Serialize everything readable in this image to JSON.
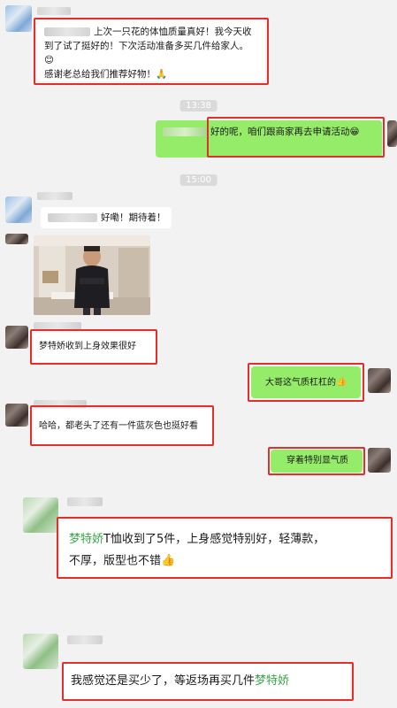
{
  "timestamps": [
    "13:38",
    "15:00"
  ],
  "messages": {
    "m1": {
      "line1": "上次一只花的体恤质量真好！我今天收",
      "line2": "到了试了挺好的！下次活动准备多买几件给家人。",
      "emoji": "😊",
      "line3": "感谢老总给我们推荐好物！",
      "emoji2": "🙏"
    },
    "m2": {
      "text": "好的呢，咱们跟商家再去申请活动",
      "emoji": "😁"
    },
    "m3": {
      "text": "好嘞！期待着！"
    },
    "m4": {
      "text": "梦特娇收到上身效果很好"
    },
    "m5": {
      "text": "大哥这气质杠杠的",
      "emoji": "👍"
    },
    "m6": {
      "text": "哈哈，都老头了还有一件蓝灰色也挺好看"
    },
    "m7": {
      "text": "穿着特别显气质"
    },
    "m8": {
      "brand": "梦特娇",
      "line1_rest": "T恤收到了5件，上身感觉特别好，轻薄款，",
      "line2": "不厚，版型也不错",
      "emoji": "👍"
    },
    "m9": {
      "text": "我感觉还是买少了，等返场再买几件",
      "brand": "梦特娇"
    }
  },
  "colors": {
    "highlight_box": "#e0302c",
    "my_bubble": "#95ec69",
    "brand_text": "#3aa64a"
  }
}
